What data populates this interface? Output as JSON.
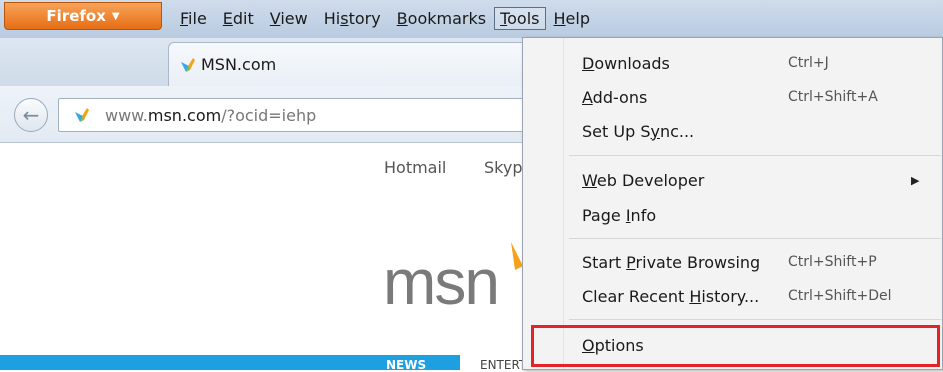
{
  "firefox_button": {
    "label": "Firefox"
  },
  "menubar": {
    "file": {
      "pre": "",
      "u": "F",
      "post": "ile"
    },
    "edit": {
      "pre": "",
      "u": "E",
      "post": "dit"
    },
    "view": {
      "pre": "",
      "u": "V",
      "post": "iew"
    },
    "history": {
      "pre": "Hi",
      "u": "s",
      "post": "tory"
    },
    "bookmarks": {
      "pre": "",
      "u": "B",
      "post": "ookmarks"
    },
    "tools": {
      "pre": "",
      "u": "T",
      "post": "ools"
    },
    "help": {
      "pre": "",
      "u": "H",
      "post": "elp"
    }
  },
  "tab": {
    "title": "MSN.com"
  },
  "urlbar": {
    "prefix": "www.",
    "host": "msn.com",
    "path": "/?ocid=iehp"
  },
  "page": {
    "links": [
      "Hotmail",
      "Skyp"
    ],
    "logo": "msn",
    "nav_news": "NEWS",
    "nav_ent": "ENTERTAINMENT"
  },
  "tools_menu": {
    "downloads": {
      "pre": "",
      "u": "D",
      "post": "ownloads",
      "shortcut": "Ctrl+J"
    },
    "addons": {
      "pre": "",
      "u": "A",
      "post": "dd-ons",
      "shortcut": "Ctrl+Shift+A"
    },
    "sync": {
      "pre": "Set Up S",
      "u": "y",
      "post": "nc..."
    },
    "webdev": {
      "pre": "",
      "u": "W",
      "post": "eb Developer"
    },
    "pageinfo": {
      "pre": "Page ",
      "u": "I",
      "post": "nfo"
    },
    "private": {
      "pre": "Start ",
      "u": "P",
      "post": "rivate Browsing",
      "shortcut": "Ctrl+Shift+P"
    },
    "clear": {
      "pre": "Clear Recent ",
      "u": "H",
      "post": "istory...",
      "shortcut": "Ctrl+Shift+Del"
    },
    "options": {
      "pre": "",
      "u": "O",
      "post": "ptions"
    }
  },
  "colors": {
    "highlight": "#e2232a",
    "firefox_orange": "#e66e14",
    "msn_blue": "#1e9fe0"
  }
}
